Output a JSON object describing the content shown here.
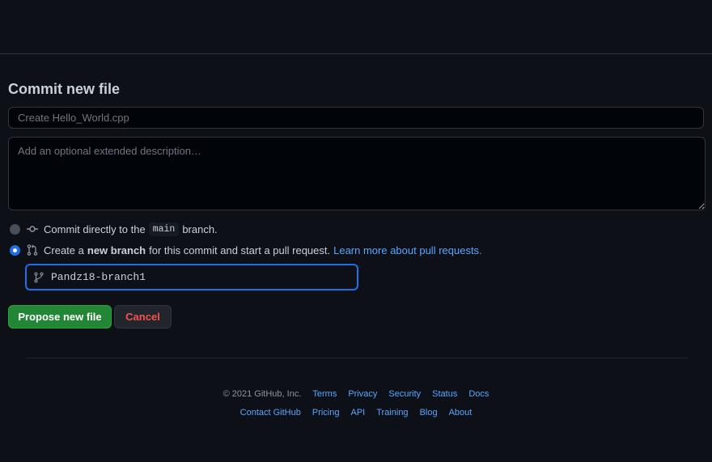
{
  "page": {
    "title": "Commit new file"
  },
  "commit": {
    "summary_placeholder": "Create Hello_World.cpp",
    "description_placeholder": "Add an optional extended description…",
    "option_direct": {
      "prefix": "Commit directly to the",
      "branch": "main",
      "suffix": "branch.",
      "selected": false
    },
    "option_new_branch": {
      "prefix": "Create a",
      "bold": "new branch",
      "suffix": "for this commit and start a pull request.",
      "link": "Learn more about pull requests.",
      "selected": true
    },
    "branch_name": "Pandz18-branch1"
  },
  "buttons": {
    "propose_label": "Propose new file",
    "cancel_label": "Cancel"
  },
  "footer": {
    "copyright": "© 2021 GitHub, Inc.",
    "row1_links": [
      "Terms",
      "Privacy",
      "Security",
      "Status",
      "Docs"
    ],
    "row2_links": [
      "Contact GitHub",
      "Pricing",
      "API",
      "Training",
      "Blog",
      "About"
    ]
  },
  "colors": {
    "background": "#0d1117",
    "accent_blue": "#58a6ff",
    "primary_green": "#238636",
    "cancel_red": "#f85149"
  }
}
